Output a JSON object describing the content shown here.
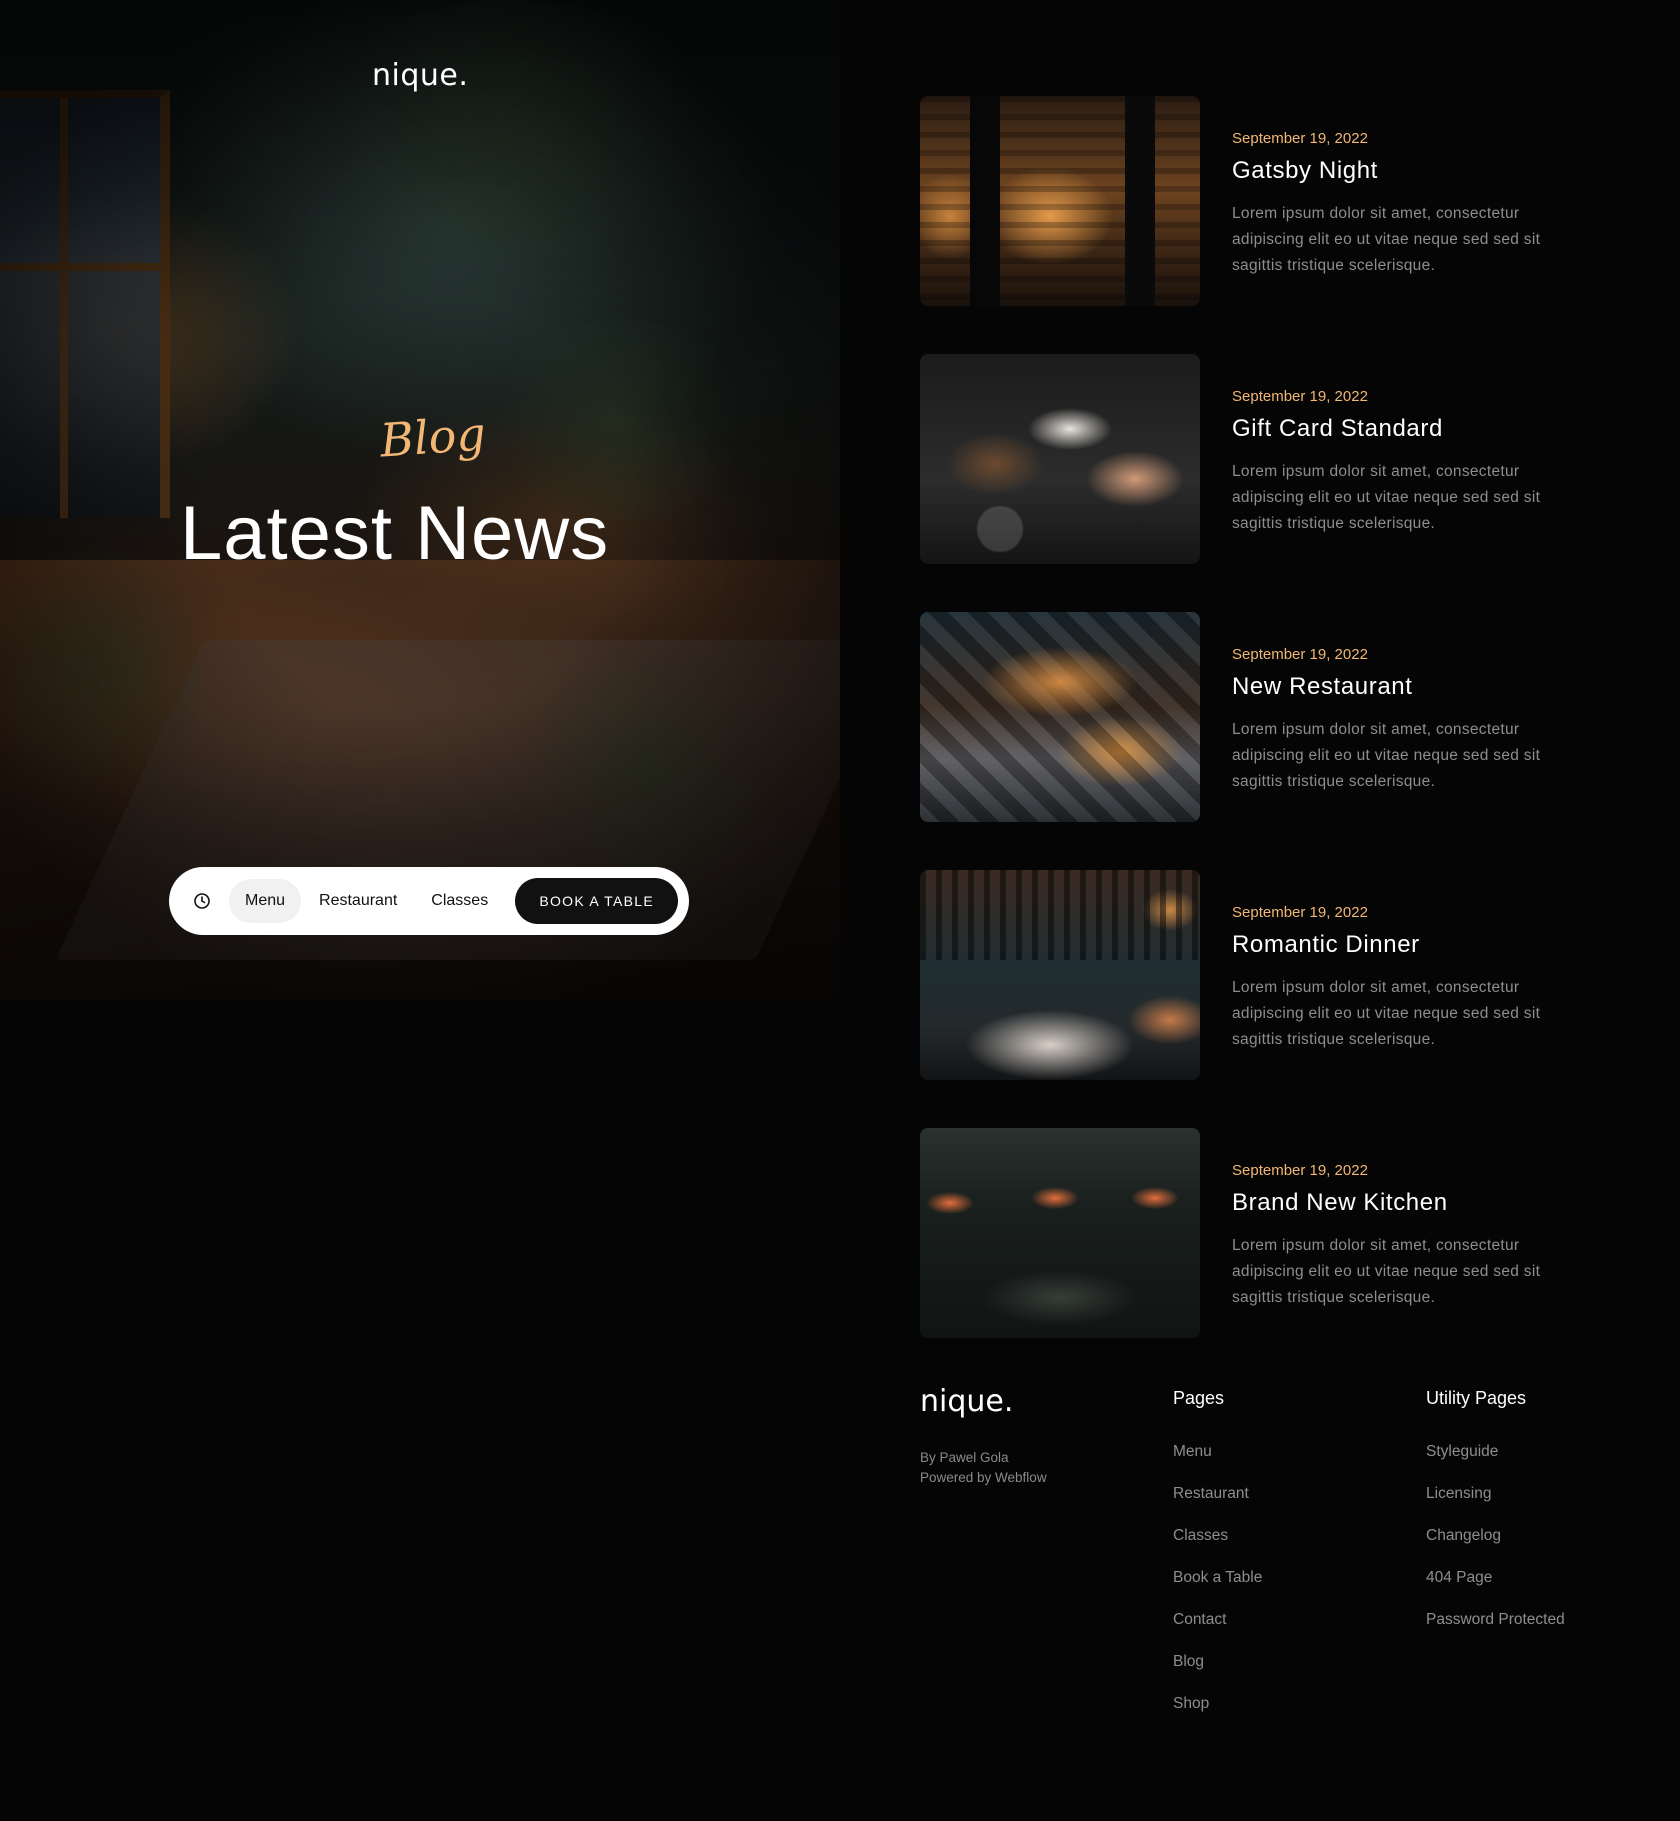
{
  "brand": {
    "logo": "nique.",
    "accent": "#f2b774"
  },
  "hero": {
    "eyebrow": "Blog",
    "title": "Latest News"
  },
  "nav": {
    "clock_icon": "clock-icon",
    "items": [
      {
        "label": "Menu",
        "active": true
      },
      {
        "label": "Restaurant",
        "active": false
      },
      {
        "label": "Classes",
        "active": false
      }
    ],
    "cta_label": "BOOK A TABLE"
  },
  "posts": [
    {
      "date": "September 19, 2022",
      "title": "Gatsby Night",
      "excerpt": "Lorem ipsum dolor sit amet, consectetur adipiscing elit eo ut vitae neque sed sed sit sagittis tristique scelerisque.",
      "image": "bar-interior-photo"
    },
    {
      "date": "September 19, 2022",
      "title": "Gift Card Standard",
      "excerpt": "Lorem ipsum dolor sit amet, consectetur adipiscing elit eo ut vitae neque sed sed sit sagittis tristique scelerisque.",
      "image": "food-plating-photo"
    },
    {
      "date": "September 19, 2022",
      "title": "New Restaurant",
      "excerpt": "Lorem ipsum dolor sit amet, consectetur adipiscing elit eo ut vitae neque sed sed sit sagittis tristique scelerisque.",
      "image": "restaurant-interior-photo"
    },
    {
      "date": "September 19, 2022",
      "title": "Romantic Dinner",
      "excerpt": "Lorem ipsum dolor sit amet, consectetur adipiscing elit eo ut vitae neque sed sed sit sagittis tristique scelerisque.",
      "image": "dining-table-photo"
    },
    {
      "date": "September 19, 2022",
      "title": "Brand New Kitchen",
      "excerpt": "Lorem ipsum dolor sit amet, consectetur adipiscing elit eo ut vitae neque sed sed sit sagittis tristique scelerisque.",
      "image": "kitchen-photo"
    }
  ],
  "footer": {
    "logo": "nique.",
    "credit_author": "By Pawel Gola",
    "credit_platform": "Powered by Webflow",
    "pages": {
      "title": "Pages",
      "links": [
        "Menu",
        "Restaurant",
        "Classes",
        "Book a Table",
        "Contact",
        "Blog",
        "Shop"
      ]
    },
    "utility": {
      "title": "Utility Pages",
      "links": [
        "Styleguide",
        "Licensing",
        "Changelog",
        "404 Page",
        "Password Protected"
      ]
    }
  }
}
